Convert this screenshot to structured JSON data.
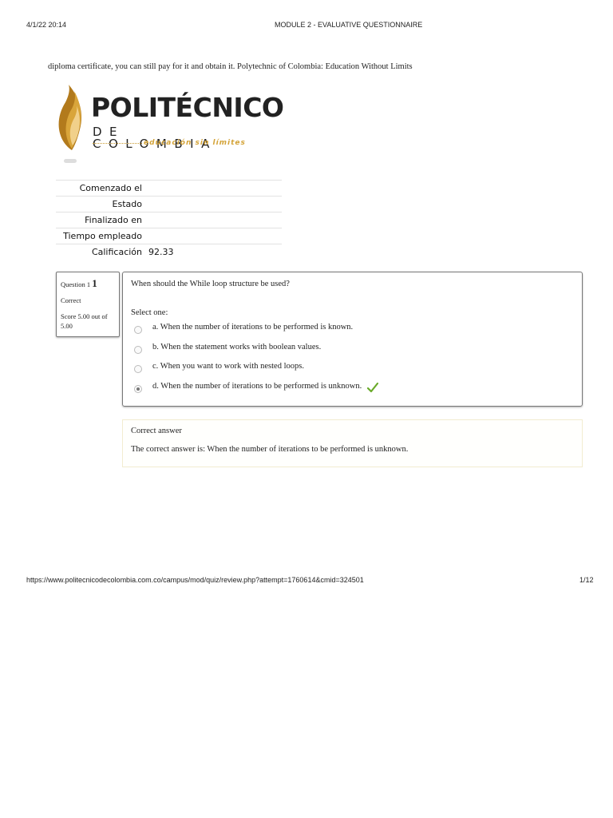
{
  "print_header": {
    "date": "4/1/22 20:14",
    "title": "MODULE 2 - EVALUATIVE QUESTIONNAIRE"
  },
  "intro_text": "diploma certificate, you can still pay for it and obtain it. Polytechnic of Colombia: Education Without Limits",
  "logo": {
    "title": "POLITÉCNICO",
    "subtitle": "DE COLOMBIA",
    "tagline": "educación sin límites"
  },
  "summary": [
    {
      "label": "Comenzado el",
      "value": ""
    },
    {
      "label": "Estado",
      "value": ""
    },
    {
      "label": "Finalizado en",
      "value": ""
    },
    {
      "label": "Tiempo empleado",
      "value": ""
    },
    {
      "label": "Calificación",
      "value": "92.33"
    }
  ],
  "question": {
    "label": "Question 1",
    "number": "1",
    "state": "Correct",
    "score": "Score 5.00 out of 5.00",
    "text": "When should the While loop structure be used?",
    "prompt": "Select one:",
    "options": [
      {
        "text": "a. When the number of iterations to be performed is known.",
        "selected": false
      },
      {
        "text": "b. When the statement works with boolean values.",
        "selected": false
      },
      {
        "text": "c. When you want to work with nested loops.",
        "selected": false
      },
      {
        "text": "d. When the number of iterations to be performed is unknown.",
        "selected": true
      }
    ],
    "check_icon": "checkmark-icon"
  },
  "feedback": {
    "title": "Correct answer",
    "text": "The correct answer is: When the number of iterations to be performed is unknown."
  },
  "print_footer": {
    "url": "https://www.politecnicodecolombia.com.co/campus/mod/quiz/review.php?attempt=1760614&cmid=324501",
    "page": "1/12"
  },
  "colors": {
    "accent_gold": "#d4a43a",
    "check_green": "#6aaa2a"
  }
}
